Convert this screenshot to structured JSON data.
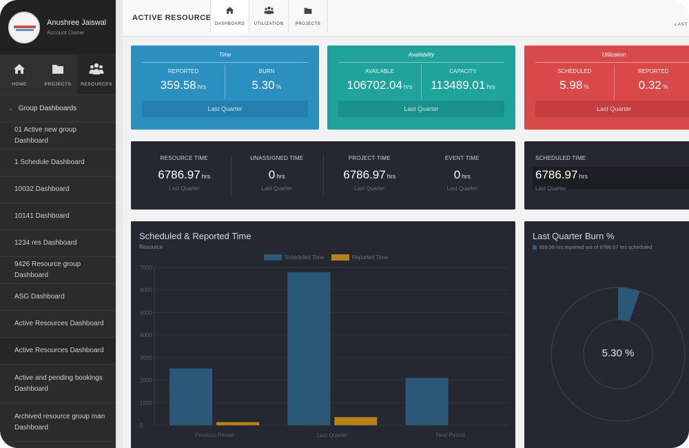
{
  "profile": {
    "name": "Anushree Jaiswal",
    "role": "Account Owner"
  },
  "nav": [
    {
      "label": "HOME",
      "icon": "home-icon"
    },
    {
      "label": "PROJECTS",
      "icon": "folder-icon"
    },
    {
      "label": "RESOURCES",
      "icon": "users-icon"
    }
  ],
  "sidebar": {
    "group_header": "Group Dashboards",
    "items": [
      "01 Active new group Dashboard",
      "1 Schedule Dashboard",
      "10032 Dashboard",
      "10141 Dashboard",
      "1234 res Dashboard",
      "9426 Resource group Dashboard",
      "ASG Dashboard",
      "Active Resources Dashboard",
      "Active Resources Dashboard",
      "Active and pending bookings Dashboard",
      "Archived resource group man Dashboard"
    ]
  },
  "topbar": {
    "title": "ACTIVE RESOURCES",
    "tabs": [
      {
        "label": "DASHBOARD",
        "icon": "home-icon"
      },
      {
        "label": "UTILIZATION",
        "icon": "users-icon"
      },
      {
        "label": "PROJECTS",
        "icon": "folder-icon"
      }
    ],
    "right_text": "LAST"
  },
  "cards": {
    "time": {
      "title": "Time",
      "left_label": "REPORTED",
      "left_value": "359.58",
      "left_unit": "hrs",
      "right_label": "BURN",
      "right_value": "5.30",
      "right_unit": "%",
      "footer": "Last Quarter"
    },
    "availability": {
      "title": "Availability",
      "left_label": "AVAILABLE",
      "left_value": "106702.04",
      "left_unit": "hrs",
      "right_label": "CAPACITY",
      "right_value": "113489.01",
      "right_unit": "hrs",
      "footer": "Last Quarter"
    },
    "utilization": {
      "title": "Utilization",
      "left_label": "SCHEDULED",
      "left_value": "5.98",
      "left_unit": "%",
      "right_label": "REPORTED",
      "right_value": "0.32",
      "right_unit": "%",
      "footer": "Last Quarter"
    }
  },
  "stats": [
    {
      "label": "RESOURCE TIME",
      "value": "6786.97",
      "unit": "hrs",
      "period": "Last Quarter"
    },
    {
      "label": "UNASSIGNED TIME",
      "value": "0",
      "unit": "hrs",
      "period": "Last Quarter"
    },
    {
      "label": "PROJECT TIME",
      "value": "6786.97",
      "unit": "hrs",
      "period": "Last Quarter"
    },
    {
      "label": "EVENT TIME",
      "value": "0",
      "unit": "hrs",
      "period": "Last Quarter"
    }
  ],
  "scheduled": {
    "label": "SCHEDULED TIME",
    "value": "6786.97",
    "unit": "hrs",
    "period": "Last Quarter"
  },
  "bar_chart": {
    "title": "Scheduled & Reported Time",
    "subtitle": "Resource",
    "legend": [
      "Scheduled Time",
      "Reported Time"
    ]
  },
  "donut": {
    "title": "Last Quarter Burn %",
    "subtitle": "359.58 hrs reported out of 6786.97 hrs scheduled",
    "center_label": "5.30 %"
  },
  "colors": {
    "time_card": "#2b8fbf",
    "availability_card": "#1fa39b",
    "utilization_card": "#d9494a",
    "scheduled_series": "#2c5878",
    "reported_series": "#b8821a",
    "panel_bg": "#252830"
  },
  "chart_data": [
    {
      "type": "bar",
      "title": "Scheduled & Reported Time",
      "subtitle": "Resource",
      "categories": [
        "Previous Period",
        "Last Quarter",
        "Next Period"
      ],
      "series": [
        {
          "name": "Scheduled Time",
          "values": [
            2520,
            6787,
            2100
          ],
          "color": "#2c5878"
        },
        {
          "name": "Reported Time",
          "values": [
            140,
            360,
            0
          ],
          "color": "#b8821a"
        }
      ],
      "yticks": [
        0,
        1000,
        2000,
        3000,
        4000,
        5000,
        6000,
        7000
      ],
      "ylim": [
        0,
        7000
      ],
      "legend": "top-center",
      "grid": true
    },
    {
      "type": "pie",
      "title": "Last Quarter Burn %",
      "subtitle": "359.58 hrs reported out of 6786.97 hrs scheduled",
      "values": [
        5.3,
        94.7
      ],
      "colors": [
        "#2c5878",
        "#252830"
      ],
      "center_label": "5.30 %",
      "donut": true
    }
  ]
}
